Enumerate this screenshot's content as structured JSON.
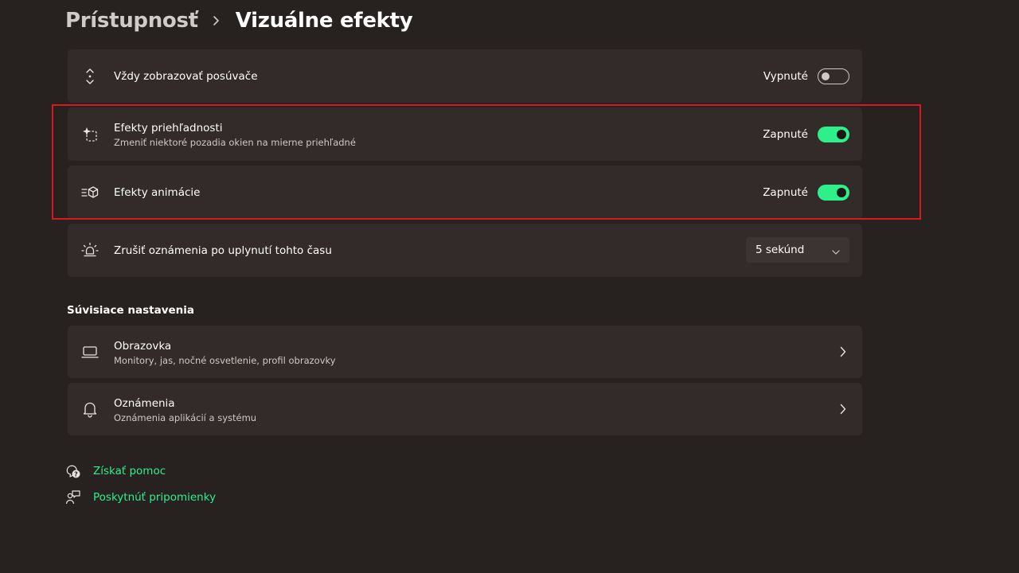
{
  "breadcrumb": {
    "parent": "Prístupnosť",
    "current": "Vizuálne efekty"
  },
  "settings": {
    "scrollbars": {
      "title": "Vždy zobrazovať posúvače",
      "state_label": "Vypnuté",
      "enabled": false,
      "icon": "scrollbar-arrows-icon"
    },
    "transparency": {
      "title": "Efekty priehľadnosti",
      "subtitle": "Zmeniť niektoré pozadia okien na mierne priehľadné",
      "state_label": "Zapnuté",
      "enabled": true,
      "icon": "transparency-icon"
    },
    "animation": {
      "title": "Efekty animácie",
      "state_label": "Zapnuté",
      "enabled": true,
      "icon": "animation-icon"
    },
    "notifications_timeout": {
      "title": "Zrušiť oznámenia po uplynutí tohto času",
      "selected": "5 sekúnd",
      "icon": "sun-bell-icon"
    }
  },
  "related": {
    "heading": "Súvisiace nastavenia",
    "items": [
      {
        "title": "Obrazovka",
        "subtitle": "Monitory, jas, nočné osvetlenie, profil obrazovky",
        "icon": "laptop-icon"
      },
      {
        "title": "Oznámenia",
        "subtitle": "Oznámenia aplikácií a systému",
        "icon": "bell-icon"
      }
    ]
  },
  "links": {
    "help": "Získať pomoc",
    "feedback": "Poskytnúť pripomienky"
  },
  "colors": {
    "accent": "#2ef08a",
    "background": "#272120",
    "card": "#322b29",
    "highlight": "#d9181f"
  }
}
